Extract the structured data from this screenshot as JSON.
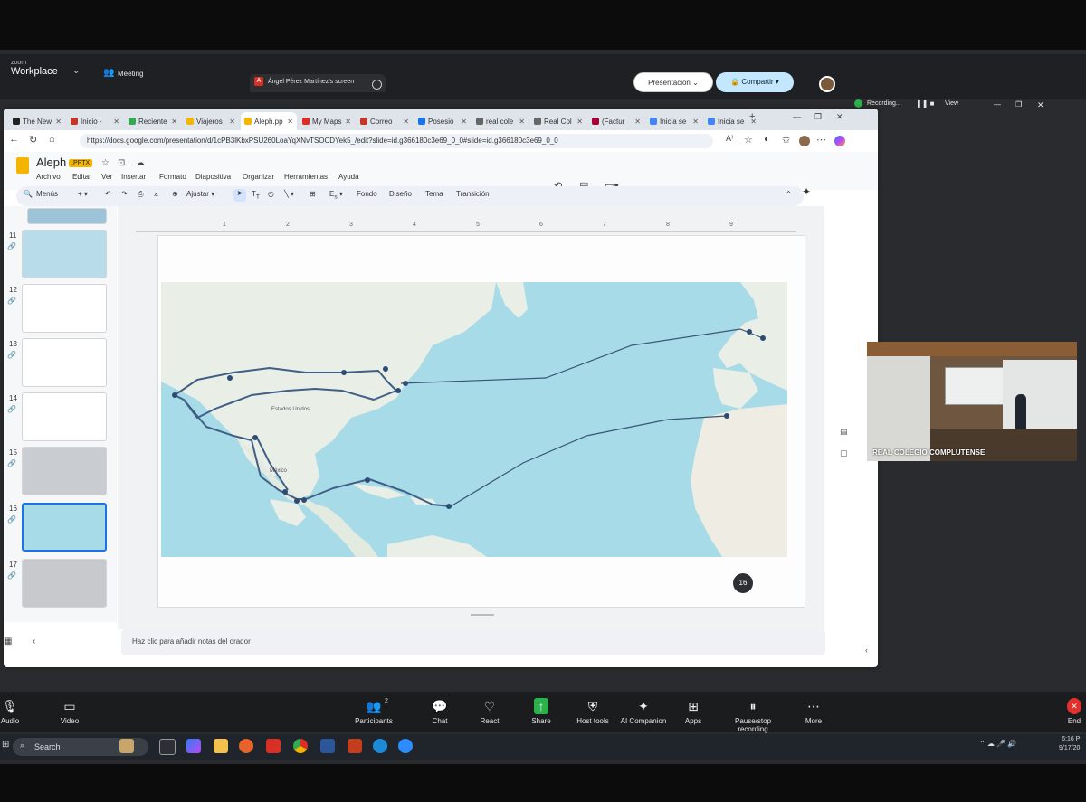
{
  "zoom": {
    "brand_small": "zoom",
    "brand": "Workplace",
    "meeting_label": "Meeting",
    "share_tab_label": "Ángel Pérez Martínez's screen",
    "recording_label": "Recording...",
    "view_label": "View",
    "participants_count": "2",
    "toolbar": [
      {
        "label": "Audio",
        "icon": "microphone-icon"
      },
      {
        "label": "Video",
        "icon": "camera-icon"
      },
      {
        "label": "Participants",
        "icon": "people-icon"
      },
      {
        "label": "Chat",
        "icon": "chat-icon"
      },
      {
        "label": "React",
        "icon": "heart-icon"
      },
      {
        "label": "Share",
        "icon": "share-arrow-icon"
      },
      {
        "label": "Host tools",
        "icon": "shield-icon"
      },
      {
        "label": "AI Companion",
        "icon": "sparkle-icon"
      },
      {
        "label": "Apps",
        "icon": "apps-icon"
      },
      {
        "label": "Pause/stop recording",
        "icon": "pause-stop-icon"
      },
      {
        "label": "More",
        "icon": "more-icon"
      },
      {
        "label": "End",
        "icon": "close-icon"
      }
    ],
    "webcam_label": "REAL COLEGIO COMPLUTENSE"
  },
  "browser": {
    "tabs": [
      {
        "label": "The New",
        "color": "#222222"
      },
      {
        "label": "Inicio -",
        "color": "#c0392b"
      },
      {
        "label": "Reciente",
        "color": "#34a853"
      },
      {
        "label": "Viajeros",
        "color": "#f4b400"
      },
      {
        "label": "Aleph.pp",
        "color": "#f4b400"
      },
      {
        "label": "My Maps",
        "color": "#d93025"
      },
      {
        "label": "Correo",
        "color": "#c0392b"
      },
      {
        "label": "Posesió",
        "color": "#1a73e8"
      },
      {
        "label": "real cole",
        "color": "#666666"
      },
      {
        "label": "Real Col",
        "color": "#666666"
      },
      {
        "label": "(Factur",
        "color": "#a50034"
      },
      {
        "label": "Inicia se",
        "color": "#4285f4"
      },
      {
        "label": "Inicia se",
        "color": "#4285f4"
      }
    ],
    "active_tab_index": 4,
    "url": "https://docs.google.com/presentation/d/1cPB3lKbxPSU260LoaYqXNvTSOCDYek5_/edit?slide=id.g366180c3e69_0_0#slide=id.g366180c3e69_0_0"
  },
  "slides": {
    "title": "Aleph",
    "badge": ".PPTX",
    "menus": [
      "Archivo",
      "Editar",
      "Ver",
      "Insertar",
      "Formato",
      "Diapositiva",
      "Organizar",
      "Herramientas",
      "Ayuda"
    ],
    "toolbar": {
      "menus": "Menús",
      "zoom": "Ajustar",
      "fondo": "Fondo",
      "diseno": "Diseño",
      "tema": "Tema",
      "transicion": "Transición"
    },
    "present_label": "Presentación",
    "share_label": "Compartir",
    "slide_numbers": [
      "11",
      "12",
      "13",
      "14",
      "15",
      "16",
      "17"
    ],
    "current_slide": "16",
    "ruler_numbers": [
      "1",
      "2",
      "3",
      "4",
      "5",
      "6",
      "7",
      "8",
      "9"
    ],
    "notes_placeholder": "Haz clic para añadir notas del orador",
    "map_country_label": "Estados Unidos",
    "map_mexico_label": "México"
  },
  "taskbar": {
    "search_placeholder": "Search",
    "time": "6:16 P",
    "date": "9/17/20"
  }
}
